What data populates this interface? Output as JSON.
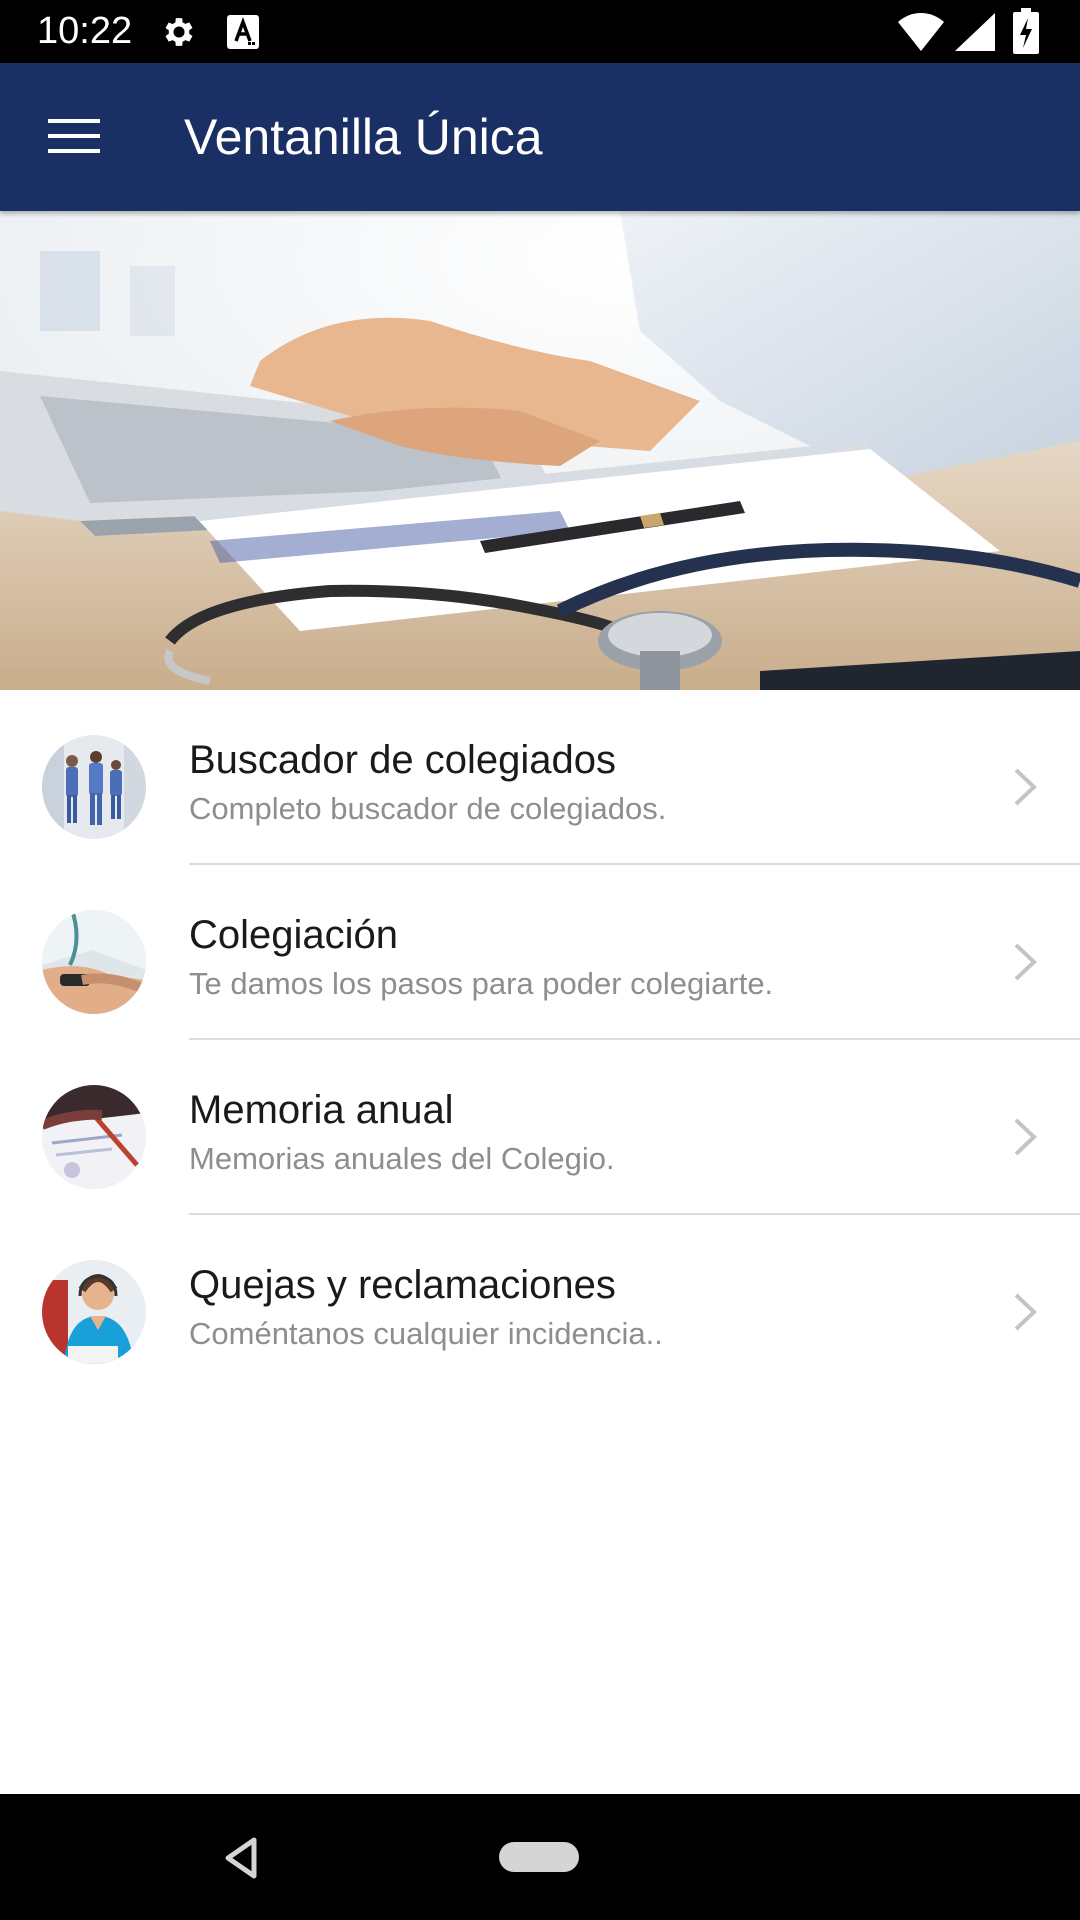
{
  "status_bar": {
    "time": "10:22",
    "icons": [
      "gear-icon",
      "font-a-icon",
      "wifi-icon",
      "signal-icon",
      "battery-charging-icon"
    ]
  },
  "app_bar": {
    "title": "Ventanilla Única",
    "background_color": "#1a2f63",
    "menu_icon": "hamburger-menu-icon"
  },
  "hero": {
    "image": "laptop-stethoscope-desk-photo"
  },
  "menu": {
    "items": [
      {
        "title": "Buscador de colegiados",
        "subtitle": "Completo buscador de colegiados.",
        "thumbnail": "nurses-walking-photo"
      },
      {
        "title": "Colegiación",
        "subtitle": "Te damos los pasos para poder colegiarte.",
        "thumbnail": "doctor-hands-photo"
      },
      {
        "title": "Memoria anual",
        "subtitle": "Memorias anuales del Colegio.",
        "thumbnail": "documents-pen-photo"
      },
      {
        "title": "Quejas y reclamaciones",
        "subtitle": "Coméntanos cualquier incidencia..",
        "thumbnail": "nurse-headset-photo"
      }
    ]
  },
  "nav_bar": {
    "icons": [
      "back-icon",
      "home-pill-icon"
    ]
  }
}
